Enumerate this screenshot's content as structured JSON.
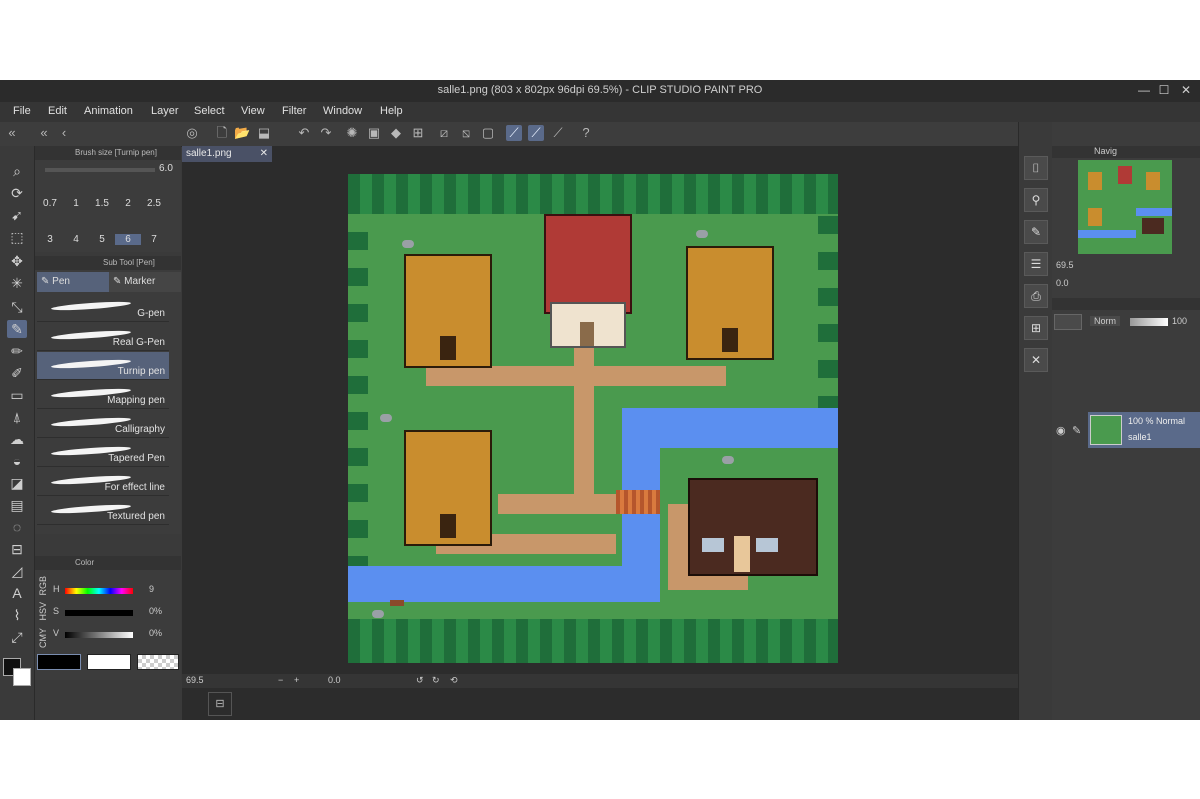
{
  "window": {
    "title": "salle1.png (803 x 802px 96dpi 69.5%)  - CLIP STUDIO PAINT PRO",
    "minimize": "—",
    "maximize": "☐",
    "close": "✕"
  },
  "menu": [
    "File",
    "Edit",
    "Animation",
    "Layer",
    "Select",
    "View",
    "Filter",
    "Window",
    "Help"
  ],
  "brush_size": {
    "header": "Brush size [Turnip pen]",
    "current": "6.0",
    "sizes": [
      "0.7",
      "1",
      "1.5",
      "2",
      "2.5",
      "3",
      "4",
      "5",
      "6",
      "7"
    ],
    "active_index": 8
  },
  "sub_tool": {
    "header": "Sub Tool [Pen]",
    "tabs": [
      "Pen",
      "Marker"
    ],
    "brushes": [
      "G-pen",
      "Real G-Pen",
      "Turnip pen",
      "Mapping pen",
      "Calligraphy",
      "Tapered Pen",
      "For effect line",
      "Textured pen"
    ],
    "active_index": 2
  },
  "color_panel": {
    "header": "Color",
    "mode_labels": [
      "RGB",
      "HSV",
      "CMY"
    ],
    "rows": [
      {
        "label": "H",
        "value": "9"
      },
      {
        "label": "S",
        "value": "0%"
      },
      {
        "label": "V",
        "value": "0%"
      }
    ]
  },
  "document": {
    "tab": "salle1.png",
    "zoom": "69.5",
    "angle": "0.0"
  },
  "navigator": {
    "header": "Navig",
    "zoom": "69.5",
    "angle": "0.0"
  },
  "layer_panel": {
    "blend_mode": "Norm",
    "opacity": "100",
    "layer_info": "100 % Normal",
    "layer_name": "salle1"
  },
  "colors": {
    "accent": "#5a6a8a",
    "grass": "#4a9a4e",
    "water": "#5b8ff0",
    "path": "#c8976a",
    "roof_red": "#b03a36",
    "roof_wood": "#c98d2e"
  }
}
